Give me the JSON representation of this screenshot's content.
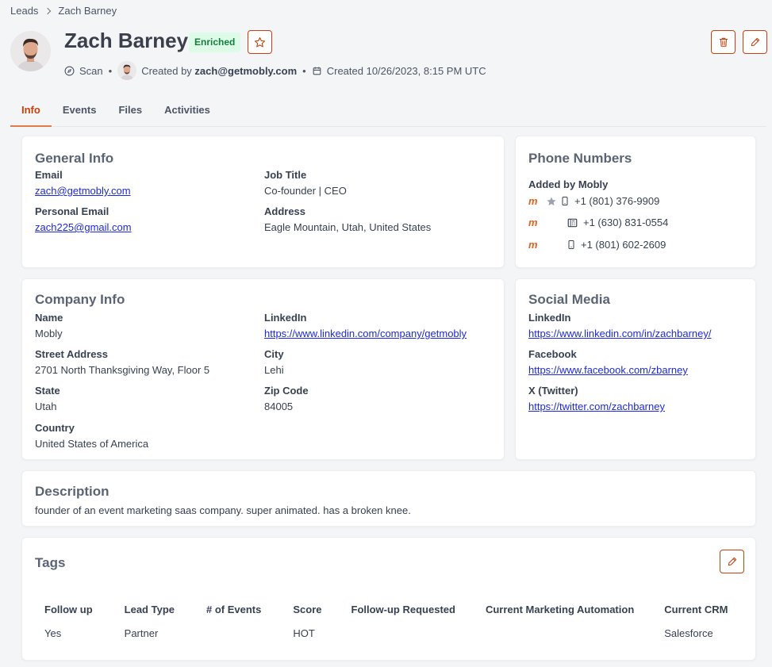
{
  "breadcrumb": {
    "root": "Leads",
    "current": "Zach Barney"
  },
  "lead": {
    "name": "Zach Barney",
    "badge": "Enriched",
    "source": "Scan",
    "created_by_prefix": "Created by",
    "created_by": "zach@getmobly.com",
    "created_at": "Created 10/26/2023, 8:15 PM UTC"
  },
  "tabs": [
    "Info",
    "Events",
    "Files",
    "Activities"
  ],
  "general_info": {
    "title": "General Info",
    "email_label": "Email",
    "email": "zach@getmobly.com",
    "personal_email_label": "Personal Email",
    "personal_email": "zach225@gmail.com",
    "job_title_label": "Job Title",
    "job_title": "Co-founder | CEO",
    "address_label": "Address",
    "address": "Eagle Mountain, Utah, United States"
  },
  "phone_numbers": {
    "title": "Phone Numbers",
    "group_label": "Added by Mobly",
    "items": [
      {
        "logo": "m",
        "type_icon": "mobile-icon",
        "starred": true,
        "number": "+1 (801) 376-9909"
      },
      {
        "logo": "m",
        "type_icon": "office-phone-icon",
        "starred": false,
        "number": "+1 (630) 831-0554"
      },
      {
        "logo": "m",
        "type_icon": "mobile-icon",
        "starred": false,
        "number": "+1 (801) 602-2609"
      }
    ]
  },
  "company_info": {
    "title": "Company Info",
    "name_label": "Name",
    "name": "Mobly",
    "linkedin_label": "LinkedIn",
    "linkedin": "https://www.linkedin.com/company/getmobly",
    "street_label": "Street Address",
    "street": "2701 North Thanksgiving Way, Floor 5",
    "city_label": "City",
    "city": "Lehi",
    "state_label": "State",
    "state": "Utah",
    "zip_label": "Zip Code",
    "zip": "84005",
    "country_label": "Country",
    "country": "United States of America"
  },
  "social_media": {
    "title": "Social Media",
    "linkedin_label": "LinkedIn",
    "linkedin": "https://www.linkedin.com/in/zachbarney/",
    "facebook_label": "Facebook",
    "facebook": "https://www.facebook.com/zbarney",
    "twitter_label": "X (Twitter)",
    "twitter": "https://twitter.com/zachbarney"
  },
  "description": {
    "title": "Description",
    "text": "founder of an event marketing saas company. super animated. has a broken knee."
  },
  "tags": {
    "title": "Tags",
    "columns": [
      "Follow up",
      "Lead Type",
      "# of Events",
      "Score",
      "Follow-up Requested",
      "Current Marketing Automation",
      "Current CRM"
    ],
    "values": [
      "Yes",
      "Partner",
      "",
      "HOT",
      "",
      "",
      "Salesforce"
    ]
  },
  "colors": {
    "accent": "#c2410c",
    "badge_bg": "#dcfce7",
    "badge_text": "#15803d",
    "link": "#1d2ad8"
  }
}
